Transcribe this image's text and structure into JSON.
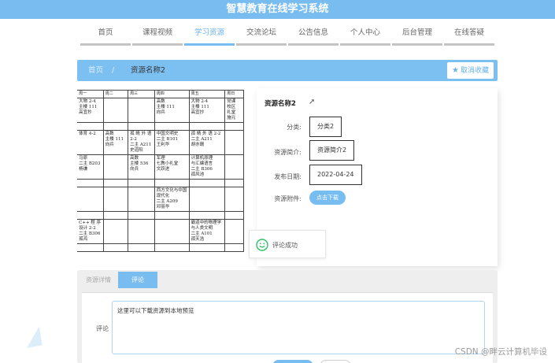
{
  "header": {
    "title": "智慧教育在线学习系统"
  },
  "nav": {
    "items": [
      "首页",
      "课程视频",
      "学习资源",
      "交流论坛",
      "公告信息",
      "个人中心",
      "后台管理",
      "在线答疑"
    ],
    "active_index": 2
  },
  "breadcrumb": {
    "home": "首页",
    "separator": "/",
    "current": "资源名称2"
  },
  "actions": {
    "cancel_collect": "取消收藏"
  },
  "schedule": {
    "headers": [
      "次",
      "周一",
      "周二",
      "周三",
      "周四",
      "周五",
      "周日"
    ],
    "rows": [
      [
        "",
        "大物 2-4\n主楼 111\n高宜抄",
        "",
        "",
        "高数\n主楼 111\n向兵",
        "大物 2-4\n主楼 111\n高宜抄",
        "党课\n校区\n礼堂\n施元"
      ],
      [
        "",
        "",
        "",
        "",
        "",
        "",
        ""
      ],
      [
        "",
        "体育 4-2",
        "高数\n主楼 111\n向兵",
        "孤 睛 外 语 2-2\n二主 A211\n史道阳",
        "中国文明史\n二主 B101\n王利华",
        "孤 睛 外 语 2-2\n二主 A211\n胡亦珊",
        ""
      ],
      [
        "",
        "马原\n二主 B203\n杨谦",
        "",
        "高数\n主楼 536\n向兵",
        "军理\n七教小礼堂\n文跃进",
        "计算机原理\n与汇编语言\n二主 B306\n孤风池",
        ""
      ],
      [
        "",
        "",
        "",
        "",
        "",
        "",
        ""
      ],
      [
        "",
        "",
        "",
        "",
        "西方文化与中国现代化\n二主 A209\n邓丽华",
        "",
        ""
      ],
      [
        "",
        "",
        "",
        "",
        "",
        "",
        ""
      ],
      [
        "",
        "C++ 程 序 设计 2-2\n二主 B306\n孤鸿",
        "",
        "",
        "",
        "霸道中的物理学与人类文明\n二主 A101\n孤天浩",
        ""
      ],
      [
        "",
        "",
        "",
        "",
        "",
        "",
        ""
      ]
    ]
  },
  "resource": {
    "title": "资源名称2",
    "category_label": "分类:",
    "category_value": "分类2",
    "intro_label": "资源简介:",
    "intro_value": "资源简介2",
    "date_label": "发布日期:",
    "date_value": "2022-04-24",
    "attachment_label": "资源附件:",
    "download_label": "点击下载"
  },
  "toast": {
    "text": "评论成功"
  },
  "tabs": {
    "details": "资源详情",
    "comment": "评论"
  },
  "comment": {
    "label": "评论",
    "value": "这里可以下载资源到本地预览"
  },
  "watermark": "CSDN @畔云计算机毕设",
  "colors": {
    "primary": "#79bdf0",
    "accent_text": "#6ab3ec",
    "toast_icon": "#2ec26a"
  }
}
